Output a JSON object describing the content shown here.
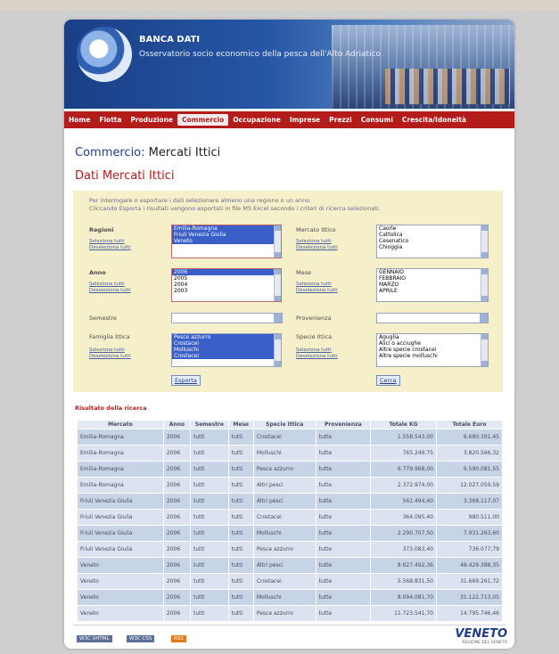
{
  "header": {
    "title": "BANCA DATI",
    "subtitle": "Osservatorio socio economico della pesca dell'Alto Adriatico"
  },
  "nav": [
    "Home",
    "Flotta",
    "Produzione",
    "Commercio",
    "Occupazione",
    "Imprese",
    "Prezzi",
    "Consumi",
    "Crescita/Idoneità"
  ],
  "page": {
    "title_prefix": "Commercio:",
    "title_rest": " Mercati Ittici",
    "subtitle": "Dati Mercati Ittici",
    "intro_1": "Per interrogare o esportare i dati selezionare almeno una regione o un anno.",
    "intro_2": "Cliccando Esporta i risultati vengono esportati in file MS Excel secondo i criteri di ricerca selezionati."
  },
  "form": {
    "select_all": "Seleziona tutti",
    "deselect_all": "Deseleziona tutti",
    "regioni": {
      "label": "Regioni",
      "options": [
        "Emilia-Romagna",
        "Friuli Venezia Giulia",
        "Veneto"
      ]
    },
    "mercato": {
      "label": "Mercato Ittico",
      "options": [
        "Caorle",
        "Cattolica",
        "Cesenatico",
        "Chioggia"
      ]
    },
    "anno": {
      "label": "Anno",
      "options": [
        "2006",
        "2005",
        "2004",
        "2003"
      ]
    },
    "mese": {
      "label": "Mese",
      "options": [
        "GENNAIO",
        "FEBBRAIO",
        "MARZO",
        "APRILE"
      ]
    },
    "semestre": {
      "label": "Semestre"
    },
    "provenienza": {
      "label": "Provenienza"
    },
    "famiglia": {
      "label": "Famiglia Ittica",
      "options": [
        "Pesce azzurro",
        "Crostacei",
        "Molluschi",
        "Crostacei"
      ]
    },
    "specie": {
      "label": "Specie Ittica",
      "options": [
        "Aguglia",
        "Alici o acciughe",
        "Altre specie crostacei",
        "Altre specie molluschi"
      ]
    },
    "esporta": "Esporta",
    "cerca": "Cerca"
  },
  "results": {
    "heading": "Risultato della ricerca",
    "columns": [
      "Mercato",
      "Anno",
      "Semestre",
      "Mese",
      "Specie Ittica",
      "Provenienza",
      "Totale KG",
      "Totale Euro"
    ],
    "rows": [
      [
        "Emilia-Romagna",
        "2006",
        "tutti",
        "tutti",
        "Crostacei",
        "tutte",
        "1.558.543,00",
        "6.680.391,45"
      ],
      [
        "Emilia-Romagna",
        "2006",
        "tutti",
        "tutti",
        "Molluschi",
        "tutte",
        "765.249,75",
        "3.820.566,32"
      ],
      [
        "Emilia-Romagna",
        "2006",
        "tutti",
        "tutti",
        "Pesce azzurro",
        "tutte",
        "6.779.968,00",
        "6.590.081,55"
      ],
      [
        "Emilia-Romagna",
        "2006",
        "tutti",
        "tutti",
        "Altri pesci",
        "tutte",
        "2.372.974,00",
        "12.027.059,59"
      ],
      [
        "Friuli Venezia Giulia",
        "2006",
        "tutti",
        "tutti",
        "Altri pesci",
        "tutte",
        "561.494,40",
        "3.368.117,07"
      ],
      [
        "Friuli Venezia Giulia",
        "2006",
        "tutti",
        "tutti",
        "Crostacei",
        "tutte",
        "364.095,40",
        "980.511,00"
      ],
      [
        "Friuli Venezia Giulia",
        "2006",
        "tutti",
        "tutti",
        "Molluschi",
        "tutte",
        "2.290.707,50",
        "7.931.263,60"
      ],
      [
        "Friuli Venezia Giulia",
        "2006",
        "tutti",
        "tutti",
        "Pesce azzurro",
        "tutte",
        "373.083,40",
        "736.077,79"
      ],
      [
        "Veneto",
        "2006",
        "tutti",
        "tutti",
        "Altri pesci",
        "tutte",
        "8.627.492,36",
        "48.429.388,35"
      ],
      [
        "Veneto",
        "2006",
        "tutti",
        "tutti",
        "Crostacei",
        "tutte",
        "5.568.831,50",
        "31.669.261,72"
      ],
      [
        "Veneto",
        "2006",
        "tutti",
        "tutti",
        "Molluschi",
        "tutte",
        "8.094.081,70",
        "31.122.713,05"
      ],
      [
        "Veneto",
        "2006",
        "tutti",
        "tutti",
        "Pesce azzurro",
        "tutte",
        "11.723.541,70",
        "14.795.746,46"
      ]
    ]
  },
  "footer": {
    "badges": [
      "W3C XHTML",
      "W3C CSS",
      "RSS"
    ],
    "logo": "VENETO",
    "logo_sub": "REGIONE DEL VENETO"
  }
}
